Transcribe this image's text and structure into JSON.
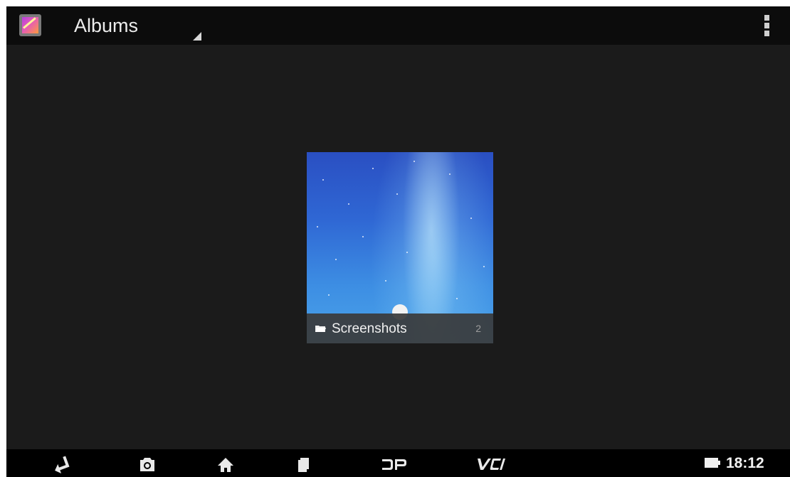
{
  "action_bar": {
    "app_icon": "gallery-icon",
    "title": "Albums",
    "overflow_icon": "overflow-menu-icon"
  },
  "albums": [
    {
      "name": "Screenshots",
      "count": "2",
      "icon": "folder-icon"
    }
  ],
  "nav_bar": {
    "buttons": [
      "back-icon",
      "camera-icon",
      "home-icon",
      "recent-apps-icon",
      "dp-icon",
      "vci-icon"
    ],
    "dp_label": "DP",
    "vci_label": "VCI",
    "battery_icon": "battery-icon",
    "time": "18:12"
  }
}
